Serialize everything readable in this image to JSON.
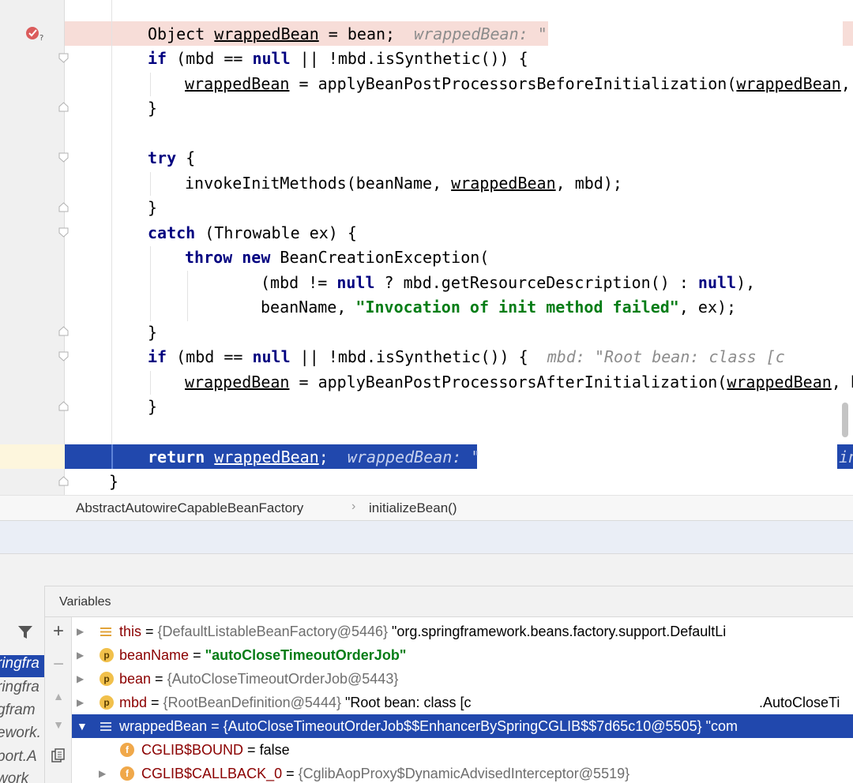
{
  "editor": {
    "lines": {
      "l1": {
        "p1": "Object ",
        "p2": "wrappedBean",
        "p3": " = bean;  ",
        "hint": "wrappedBean: \"",
        "tail": ""
      },
      "l2": {
        "kw1": "if",
        "p1": " (mbd == ",
        "kw2": "null",
        "p2": " || !mbd.isSynthetic()) {"
      },
      "l3": {
        "p1": "wrappedBean",
        "p2": " = applyBeanPostProcessorsBeforeInitialization(",
        "p3": "wrappedBean",
        "p4": ","
      },
      "l4": {
        "p1": "}"
      },
      "l6": {
        "kw1": "try",
        "p1": " {"
      },
      "l7": {
        "p1": "invokeInitMethods(beanName, ",
        "p2": "wrappedBean",
        "p3": ", mbd);"
      },
      "l8": {
        "p1": "}"
      },
      "l9": {
        "kw1": "catch",
        "p1": " (Throwable ex) {"
      },
      "l10": {
        "kw1": "throw",
        "p1": " ",
        "kw2": "new",
        "p2": " BeanCreationException("
      },
      "l11": {
        "p1": "(mbd != ",
        "kw1": "null",
        "p2": " ? mbd.getResourceDescription() : ",
        "kw2": "null",
        "p3": "),"
      },
      "l12": {
        "p1": "beanName, ",
        "str": "\"Invocation of init method failed\"",
        "p2": ", ex);"
      },
      "l13": {
        "p1": "}"
      },
      "l14": {
        "kw1": "if",
        "p1": " (mbd == ",
        "kw2": "null",
        "p2": " || !mbd.isSynthetic()) {  ",
        "hint": "mbd: \"Root bean: class [c"
      },
      "l15": {
        "p1": "wrappedBean",
        "p2": " = applyBeanPostProcessorsAfterInitialization(",
        "p3": "wrappedBean",
        "p4": ", b"
      },
      "l16": {
        "p1": "}"
      },
      "l18": {
        "kw1": "return",
        "p1": " ",
        "p2": "wrappedBean",
        "p3": ";  ",
        "hint": "wrappedBean: \"",
        "right": "in"
      },
      "l19": {
        "p1": "}"
      }
    }
  },
  "breadcrumb": {
    "class_name": "AbstractAutowireCapableBeanFactory",
    "separator": "›",
    "method": "initializeBean()"
  },
  "debug": {
    "variables_title": "Variables",
    "frames": [
      "ringfra",
      "ringfra",
      "gfram",
      "ework.",
      "port.A",
      "work"
    ],
    "tools": {
      "add": "+",
      "remove": "−",
      "up": "▲",
      "down": "▼"
    },
    "rows": {
      "this": {
        "name": "this",
        "eq": " = ",
        "ref": "{DefaultListableBeanFactory@5446}",
        "val": " \"org.springframework.beans.factory.support.DefaultLi"
      },
      "beanName": {
        "icon": "p",
        "name": "beanName",
        "eq": " = ",
        "val": "\"autoCloseTimeoutOrderJob\""
      },
      "bean": {
        "icon": "p",
        "name": "bean",
        "eq": " = ",
        "ref": "{AutoCloseTimeoutOrderJob@5443}"
      },
      "mbd": {
        "icon": "p",
        "name": "mbd",
        "eq": " = ",
        "ref": "{RootBeanDefinition@5444}",
        "val": " \"Root bean: class [c",
        "tail": ".AutoCloseTi"
      },
      "wrapped": {
        "name": "wrappedBean",
        "eq": " = ",
        "ref": "{AutoCloseTimeoutOrderJob$$EnhancerBySpringCGLIB$$7d65c10@5505}",
        "val": " \"com"
      },
      "cglib_bound": {
        "icon": "f",
        "name": "CGLIB$BOUND",
        "eq": " = ",
        "val": "false"
      },
      "cglib_cb0": {
        "icon": "f",
        "name": "CGLIB$CALLBACK_0",
        "eq": " = ",
        "ref": "{CglibAopProxy$DynamicAdvisedInterceptor@5519}"
      }
    }
  }
}
